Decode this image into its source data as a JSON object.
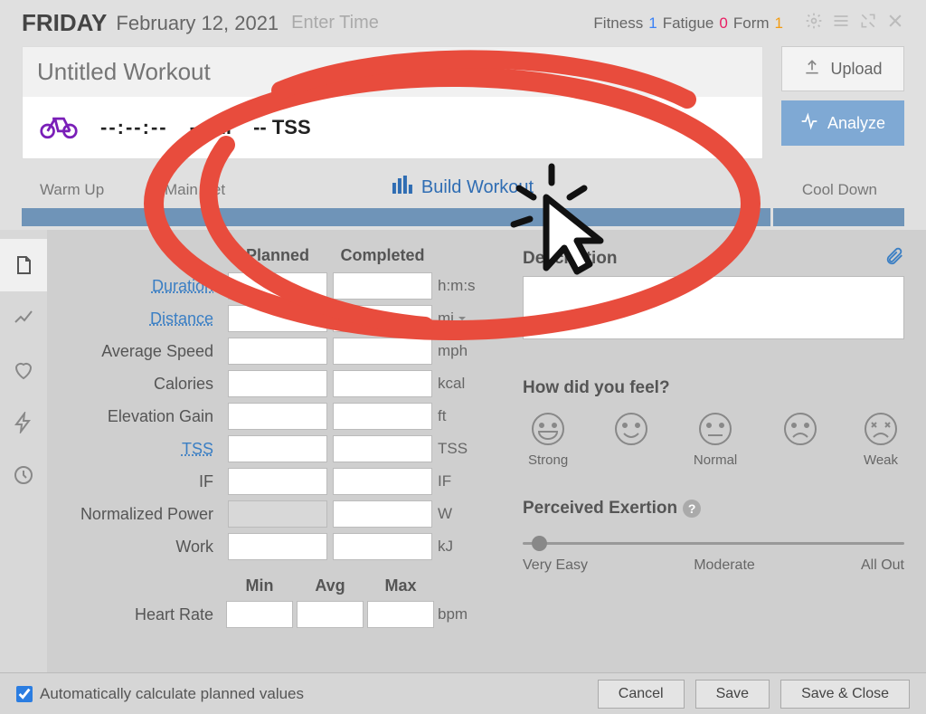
{
  "header": {
    "day": "FRIDAY",
    "date": "February 12, 2021",
    "enter_time": "Enter Time",
    "metrics": {
      "fitness_label": "Fitness",
      "fitness_value": "1",
      "fatigue_label": "Fatigue",
      "fatigue_value": "0",
      "form_label": "Form",
      "form_value": "1"
    }
  },
  "workout": {
    "title_placeholder": "Untitled Workout",
    "time_placeholder": "--:--:--",
    "dist_placeholder": "-- mi",
    "tss_placeholder": "-- TSS"
  },
  "buttons": {
    "upload": "Upload",
    "analyze": "Analyze"
  },
  "phases": {
    "warm": "Warm Up",
    "main": "Main Set",
    "cool": "Cool Down",
    "build": "Build Workout"
  },
  "summary": {
    "hdr_planned": "Planned",
    "hdr_completed": "Completed",
    "rows": [
      {
        "label": "Duration",
        "link": true,
        "unit": "h:m:s"
      },
      {
        "label": "Distance",
        "link": true,
        "unit": "mi",
        "unit_select": true
      },
      {
        "label": "Average Speed",
        "unit": "mph"
      },
      {
        "label": "Calories",
        "unit": "kcal"
      },
      {
        "label": "Elevation Gain",
        "unit": "ft"
      },
      {
        "label": "TSS",
        "link": true,
        "unit": "TSS"
      },
      {
        "label": "IF",
        "unit": "IF"
      },
      {
        "label": "Normalized Power",
        "unit": "W",
        "planned_disabled": true
      },
      {
        "label": "Work",
        "unit": "kJ"
      }
    ],
    "hr": {
      "min": "Min",
      "avg": "Avg",
      "max": "Max",
      "label": "Heart Rate",
      "unit": "bpm"
    }
  },
  "desc": {
    "label": "Description"
  },
  "feel": {
    "label": "How did you feel?",
    "faces": [
      {
        "label": "Strong",
        "type": "grin"
      },
      {
        "label": "",
        "type": "smile"
      },
      {
        "label": "Normal",
        "type": "neutral"
      },
      {
        "label": "",
        "type": "frown"
      },
      {
        "label": "Weak",
        "type": "dead"
      }
    ]
  },
  "exertion": {
    "label": "Perceived Exertion",
    "easy": "Very Easy",
    "moderate": "Moderate",
    "allout": "All Out"
  },
  "footer": {
    "auto_label": "Automatically calculate planned values",
    "cancel": "Cancel",
    "save": "Save",
    "save_close": "Save & Close"
  }
}
